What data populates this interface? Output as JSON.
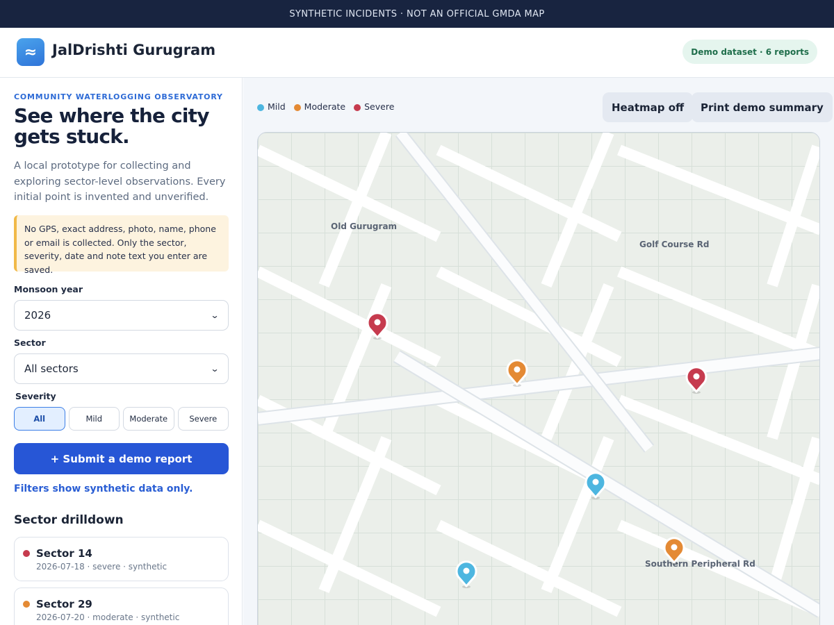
{
  "banner": {
    "text": "SYNTHETIC INCIDENTS · NOT AN OFFICIAL GMDA MAP"
  },
  "header": {
    "logo_glyph": "≈",
    "title": "JalDrishti Gurugram",
    "badge": "Demo dataset · 6 reports"
  },
  "sidebar": {
    "eyebrow": "COMMUNITY WATERLOGGING OBSERVATORY",
    "headline": "See where the city gets stuck.",
    "intro": "A local prototype for collecting and exploring sector-level observations. Every initial point is invented and unverified.",
    "privacy_note": "No GPS, exact address, photo, name, phone or email is collected. Only the sector, severity, date and note text you enter are saved.",
    "year": {
      "label": "Monsoon year",
      "value": "2026"
    },
    "sector": {
      "label": "Sector",
      "value": "All sectors"
    },
    "severity": {
      "label": "Severity",
      "options": [
        "All",
        "Mild",
        "Moderate",
        "Severe"
      ],
      "selected": "All"
    },
    "submit_label": "+ Submit a demo report",
    "filter_note": "Filters show synthetic data only.",
    "drilldown_title": "Sector drilldown",
    "drilldown": [
      {
        "sector": "Sector 14",
        "meta": "2026-07-18 · severe · synthetic",
        "color": "#c63b4e"
      },
      {
        "sector": "Sector 29",
        "meta": "2026-07-20 · moderate · synthetic",
        "color": "#e48a34"
      }
    ]
  },
  "map": {
    "legend": [
      {
        "label": "Mild",
        "color": "#4db6e0"
      },
      {
        "label": "Moderate",
        "color": "#e48a34"
      },
      {
        "label": "Severe",
        "color": "#c63b4e"
      }
    ],
    "heatmap_button": "Heatmap off",
    "print_button": "Print demo summary",
    "labels": {
      "old_gurugram": "Old Gurugram",
      "golf_course": "Golf Course Rd",
      "southern_peripheral": "Southern Peripheral Rd"
    },
    "markers": [
      {
        "severity": "severe",
        "color": "#c63b4e"
      },
      {
        "severity": "moderate",
        "color": "#e48a34"
      },
      {
        "severity": "severe",
        "color": "#c63b4e"
      },
      {
        "severity": "mild",
        "color": "#4db6e0"
      },
      {
        "severity": "moderate",
        "color": "#e48a34"
      },
      {
        "severity": "mild",
        "color": "#4db6e0"
      }
    ]
  }
}
